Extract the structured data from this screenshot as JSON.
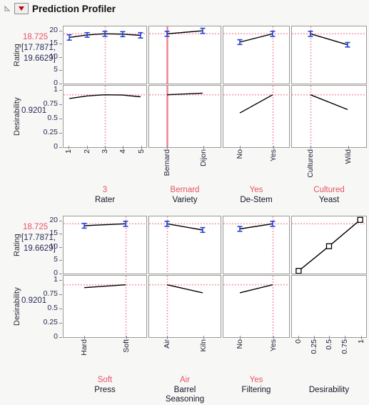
{
  "window": {
    "title": "Prediction Profiler",
    "disclosure_icon": "triangle-collapse-icon",
    "menu_icon": "red-triangle-menu-icon"
  },
  "responses": [
    {
      "id": "rating",
      "label": "Rating",
      "value": "18.725",
      "ci_line1": "[17.7871,",
      "ci_line2": "19.6629]",
      "ticks": [
        "20",
        "15",
        "10",
        "5",
        "0"
      ],
      "ylim": [
        0,
        21.5
      ],
      "ref_value": 18.725
    },
    {
      "id": "desirability",
      "label": "Desirability",
      "value": "0.9201",
      "ticks": [
        "1",
        "0.75",
        "0.5",
        "0.25",
        "0"
      ],
      "ylim": [
        0,
        1.08
      ],
      "ref_value": 0.9201
    }
  ],
  "rows": [
    {
      "id": "row-1",
      "factors": [
        {
          "id": "rater",
          "name": "Rater",
          "name_lines": [
            "Rater"
          ],
          "current": "3",
          "ticks": [
            "1",
            "2",
            "3",
            "4",
            "5"
          ],
          "marker_pos": 0.5,
          "line_style": "dotted",
          "rating": {
            "x": [
              0.07,
              0.285,
              0.5,
              0.715,
              0.93
            ],
            "y": [
              17.35,
              18.3,
              18.725,
              18.6,
              18.15
            ],
            "err": [
              1.0,
              0.85,
              0.95,
              0.95,
              1.0
            ],
            "error_bars": true
          },
          "desirability": {
            "x": [
              0.07,
              0.285,
              0.5,
              0.715,
              0.93
            ],
            "y": [
              0.855,
              0.9,
              0.9201,
              0.915,
              0.885
            ]
          }
        },
        {
          "id": "variety",
          "name": "Variety",
          "name_lines": [
            "Variety"
          ],
          "current": "Bernard",
          "ticks": [
            "Bernard",
            "Dijon"
          ],
          "marker_pos": 0.25,
          "line_style": "solid",
          "rating": {
            "x": [
              0.25,
              0.75
            ],
            "y": [
              18.725,
              19.85
            ],
            "err": [
              0.94,
              0.95
            ],
            "error_bars": true
          },
          "desirability": {
            "x": [
              0.25,
              0.75
            ],
            "y": [
              0.9201,
              0.95
            ]
          }
        },
        {
          "id": "de-stem",
          "name": "De-Stem",
          "name_lines": [
            "De-Stem"
          ],
          "current": "Yes",
          "ticks": [
            "No",
            "Yes"
          ],
          "marker_pos": 0.75,
          "line_style": "dotted",
          "rating": {
            "x": [
              0.25,
              0.75
            ],
            "y": [
              15.6,
              18.725
            ],
            "err": [
              0.9,
              0.95
            ],
            "error_bars": true
          },
          "desirability": {
            "x": [
              0.25,
              0.75
            ],
            "y": [
              0.6,
              0.9201
            ]
          }
        },
        {
          "id": "yeast",
          "name": "Yeast",
          "name_lines": [
            "Yeast"
          ],
          "current": "Cultured",
          "ticks": [
            "Cultured",
            "Wild"
          ],
          "marker_pos": 0.25,
          "line_style": "dotted",
          "rating": {
            "x": [
              0.25,
              0.75
            ],
            "y": [
              18.725,
              14.6
            ],
            "err": [
              0.95,
              0.85
            ],
            "error_bars": true
          },
          "desirability": {
            "x": [
              0.25,
              0.75
            ],
            "y": [
              0.9201,
              0.66
            ]
          }
        }
      ]
    },
    {
      "id": "row-2",
      "factors": [
        {
          "id": "press",
          "name": "Press",
          "name_lines": [
            "Press"
          ],
          "current": "Soft",
          "ticks": [
            "Hard",
            "Soft"
          ],
          "marker_pos": 0.75,
          "line_style": "dotted",
          "rating": {
            "x": [
              0.25,
              0.75
            ],
            "y": [
              18.0,
              18.725
            ],
            "err": [
              0.9,
              0.95
            ],
            "error_bars": true
          },
          "desirability": {
            "x": [
              0.25,
              0.75
            ],
            "y": [
              0.87,
              0.9201
            ]
          }
        },
        {
          "id": "barrel-seasoning",
          "name": "Barrel Seasoning",
          "name_lines": [
            "Barrel",
            "Seasoning"
          ],
          "current": "Air",
          "ticks": [
            "Air",
            "Kiln"
          ],
          "marker_pos": 0.25,
          "line_style": "dotted",
          "rating": {
            "x": [
              0.25,
              0.75
            ],
            "y": [
              18.725,
              16.4
            ],
            "err": [
              0.95,
              0.9
            ],
            "error_bars": true
          },
          "desirability": {
            "x": [
              0.25,
              0.75
            ],
            "y": [
              0.9201,
              0.78
            ]
          }
        },
        {
          "id": "filtering",
          "name": "Filtering",
          "name_lines": [
            "Filtering"
          ],
          "current": "Yes",
          "ticks": [
            "No",
            "Yes"
          ],
          "marker_pos": 0.75,
          "line_style": "dotted",
          "rating": {
            "x": [
              0.25,
              0.75
            ],
            "y": [
              16.8,
              18.725
            ],
            "err": [
              0.9,
              0.95
            ],
            "error_bars": true
          },
          "desirability": {
            "x": [
              0.25,
              0.75
            ],
            "y": [
              0.78,
              0.9201
            ]
          }
        },
        {
          "id": "desirability-factor",
          "name": "Desirability",
          "name_lines": [
            "Desirability"
          ],
          "current": "",
          "ticks": [
            "0",
            "0.25",
            "0.5",
            "0.75",
            "1"
          ],
          "marker_pos": -1,
          "line_style": "none",
          "rating": {
            "x": [
              0.09,
              0.5,
              0.92
            ],
            "y": [
              1.0,
              10.3,
              20.2
            ],
            "err": [
              0,
              0,
              0
            ],
            "error_bars": false,
            "markers": "square"
          },
          "desirability": null
        }
      ]
    }
  ],
  "colors": {
    "reference_line": "#f4a0ad",
    "current_value_text": "#e8546a",
    "marker_line_solid": "#f08090",
    "error_bar": "#2244dd",
    "trace_line": "#000000",
    "panel_border": "#9a9a9a",
    "background": "#f7f7f5"
  }
}
